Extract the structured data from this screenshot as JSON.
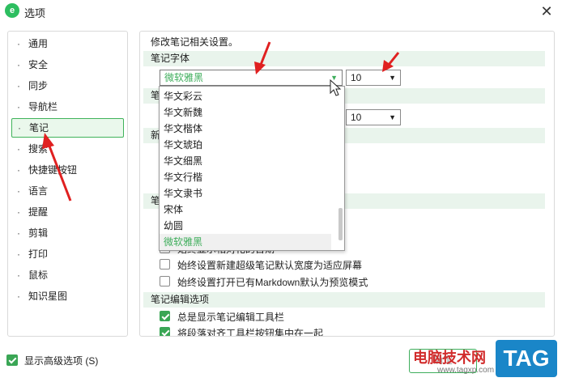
{
  "window": {
    "title": "选项",
    "app_icon_glyph": "e"
  },
  "sidebar": {
    "items": [
      {
        "label": "通用"
      },
      {
        "label": "安全"
      },
      {
        "label": "同步"
      },
      {
        "label": "导航栏"
      },
      {
        "label": "笔记",
        "selected": true
      },
      {
        "label": "搜索"
      },
      {
        "label": "快捷键按钮"
      },
      {
        "label": "语言"
      },
      {
        "label": "提醒"
      },
      {
        "label": "剪辑"
      },
      {
        "label": "打印"
      },
      {
        "label": "鼠标"
      },
      {
        "label": "知识星图"
      }
    ]
  },
  "content": {
    "description": "修改笔记相关设置。",
    "note_font_heading": "笔记字体",
    "font_select_value": "微软雅黑",
    "size_select_value": "10",
    "second_size_value": "10",
    "partial_labels": [
      "笔",
      "新",
      "笔"
    ],
    "font_options": [
      "华文彩云",
      "华文新魏",
      "华文楷体",
      "华文琥珀",
      "华文细黑",
      "华文行楷",
      "华文隶书",
      "宋体",
      "幼圆",
      "微软雅黑"
    ],
    "selected_font": "微软雅黑",
    "checkboxes": [
      {
        "label": "始终显示相对化的日期",
        "checked": false
      },
      {
        "label": "始终设置新建超级笔记默认宽度为适应屏幕",
        "checked": false
      },
      {
        "label": "始终设置打开已有Markdown默认为预览模式",
        "checked": false
      }
    ],
    "editing_heading": "笔记编辑选项",
    "editing_checkboxes": [
      {
        "label": "总是显示笔记编辑工具栏",
        "checked": true
      },
      {
        "label": "将段落对齐工具栏按钮集中在一起",
        "checked": true
      }
    ]
  },
  "footer": {
    "advanced_label": "显示高级选项 (S)",
    "advanced_checked": true,
    "ok_label": "确定"
  },
  "watermark": {
    "text": "电脑技术网",
    "url": "www.tagxp.com",
    "logo": "TAG"
  },
  "colors": {
    "accent": "#3fae5c",
    "section_bg": "#e9f4ec",
    "annotation_arrow": "#e02020"
  }
}
